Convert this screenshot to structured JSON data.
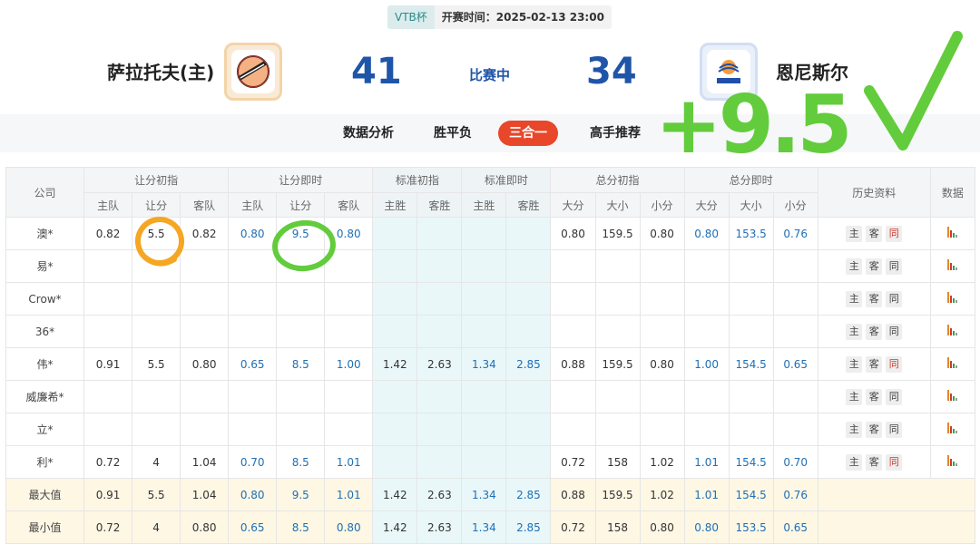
{
  "header": {
    "league": "VTB杯",
    "start_time": "开赛时间：2025-02-13 23:00",
    "home_team": "萨拉托夫(主)",
    "away_team": "恩尼斯尔",
    "home_score": "41",
    "away_score": "34",
    "status": "比赛中",
    "home_logo_icon": "saratov-logo-icon",
    "away_logo_icon": "enisey-logo-icon"
  },
  "tabs": [
    {
      "label": "数据分析",
      "active": false
    },
    {
      "label": "胜平负",
      "active": false
    },
    {
      "label": "三合一",
      "active": true
    },
    {
      "label": "高手推荐",
      "active": false
    }
  ],
  "table": {
    "col_company": "公司",
    "groups": [
      "让分初指",
      "让分即时",
      "标准初指",
      "标准即时",
      "总分初指",
      "总分即时",
      "历史资料",
      "数据"
    ],
    "sub_headers": {
      "handicap": [
        "主队",
        "让分",
        "客队"
      ],
      "standard": [
        "主胜",
        "客胜"
      ],
      "total": [
        "大分",
        "大小",
        "小分"
      ]
    },
    "rows": [
      {
        "company": "澳*",
        "h_init": [
          "0.82",
          "5.5",
          "0.82"
        ],
        "h_live": [
          "0.80",
          "9.5",
          "0.80"
        ],
        "s_init": [
          "",
          ""
        ],
        "s_live": [
          "",
          ""
        ],
        "t_init": [
          "0.80",
          "159.5",
          "0.80"
        ],
        "t_live": [
          "0.80",
          "153.5",
          "0.76"
        ],
        "same_red": true
      },
      {
        "company": "易*",
        "h_init": [
          "",
          "",
          ""
        ],
        "h_live": [
          "",
          "",
          ""
        ],
        "s_init": [
          "",
          ""
        ],
        "s_live": [
          "",
          ""
        ],
        "t_init": [
          "",
          "",
          ""
        ],
        "t_live": [
          "",
          "",
          ""
        ],
        "same_red": false
      },
      {
        "company": "Crow*",
        "h_init": [
          "",
          "",
          ""
        ],
        "h_live": [
          "",
          "",
          ""
        ],
        "s_init": [
          "",
          ""
        ],
        "s_live": [
          "",
          ""
        ],
        "t_init": [
          "",
          "",
          ""
        ],
        "t_live": [
          "",
          "",
          ""
        ],
        "same_red": false
      },
      {
        "company": "36*",
        "h_init": [
          "",
          "",
          ""
        ],
        "h_live": [
          "",
          "",
          ""
        ],
        "s_init": [
          "",
          ""
        ],
        "s_live": [
          "",
          ""
        ],
        "t_init": [
          "",
          "",
          ""
        ],
        "t_live": [
          "",
          "",
          ""
        ],
        "same_red": false
      },
      {
        "company": "伟*",
        "h_init": [
          "0.91",
          "5.5",
          "0.80"
        ],
        "h_live": [
          "0.65",
          "8.5",
          "1.00"
        ],
        "s_init": [
          "1.42",
          "2.63"
        ],
        "s_live": [
          "1.34",
          "2.85"
        ],
        "t_init": [
          "0.88",
          "159.5",
          "0.80"
        ],
        "t_live": [
          "1.00",
          "154.5",
          "0.65"
        ],
        "same_red": true
      },
      {
        "company": "威廉希*",
        "h_init": [
          "",
          "",
          ""
        ],
        "h_live": [
          "",
          "",
          ""
        ],
        "s_init": [
          "",
          ""
        ],
        "s_live": [
          "",
          ""
        ],
        "t_init": [
          "",
          "",
          ""
        ],
        "t_live": [
          "",
          "",
          ""
        ],
        "same_red": false
      },
      {
        "company": "立*",
        "h_init": [
          "",
          "",
          ""
        ],
        "h_live": [
          "",
          "",
          ""
        ],
        "s_init": [
          "",
          ""
        ],
        "s_live": [
          "",
          ""
        ],
        "t_init": [
          "",
          "",
          ""
        ],
        "t_live": [
          "",
          "",
          ""
        ],
        "same_red": false
      },
      {
        "company": "利*",
        "h_init": [
          "0.72",
          "4",
          "1.04"
        ],
        "h_live": [
          "0.70",
          "8.5",
          "1.01"
        ],
        "s_init": [
          "",
          ""
        ],
        "s_live": [
          "",
          ""
        ],
        "t_init": [
          "0.72",
          "158",
          "1.02"
        ],
        "t_live": [
          "1.01",
          "154.5",
          "0.70"
        ],
        "same_red": true
      }
    ],
    "history_buttons": [
      "主",
      "客",
      "同"
    ],
    "summary": [
      {
        "label": "最大值",
        "h_init": [
          "0.91",
          "5.5",
          "1.04"
        ],
        "h_live": [
          "0.80",
          "9.5",
          "1.01"
        ],
        "s_init": [
          "1.42",
          "2.63"
        ],
        "s_live": [
          "1.34",
          "2.85"
        ],
        "t_init": [
          "0.88",
          "159.5",
          "1.02"
        ],
        "t_live": [
          "1.01",
          "154.5",
          "0.76"
        ]
      },
      {
        "label": "最小值",
        "h_init": [
          "0.72",
          "4",
          "0.80"
        ],
        "h_live": [
          "0.65",
          "8.5",
          "0.80"
        ],
        "s_init": [
          "1.42",
          "2.63"
        ],
        "s_live": [
          "1.34",
          "2.85"
        ],
        "t_init": [
          "0.72",
          "158",
          "0.80"
        ],
        "t_live": [
          "0.80",
          "153.5",
          "0.65"
        ]
      }
    ],
    "data_icon": "bar-chart-icon"
  },
  "annotation": {
    "handwritten_text": "+9.5",
    "check_icon": "checkmark-icon",
    "colors": {
      "green": "#62cc3c",
      "orange": "#f5a623"
    }
  },
  "colors": {
    "blue": "#1f55a8",
    "link_blue": "#1f6fb5",
    "tab_active": "#e8472a",
    "std_bg": "#e9f7f9",
    "summary_bg": "#fdf7e4"
  }
}
